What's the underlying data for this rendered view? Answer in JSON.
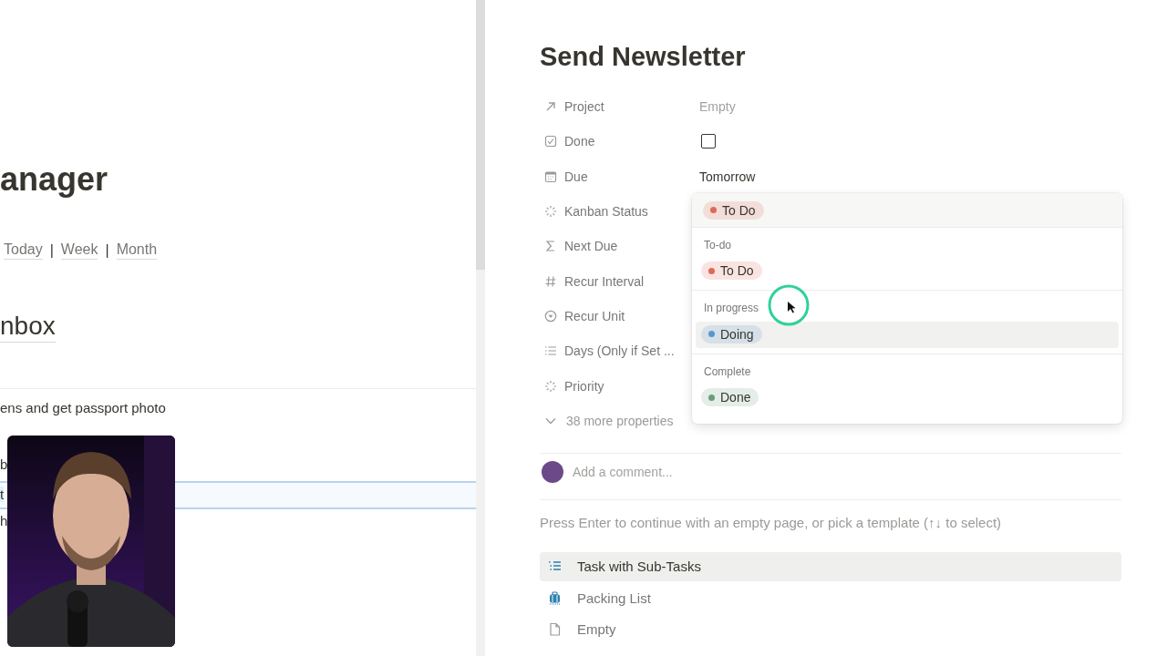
{
  "left_page": {
    "title": "anager",
    "links": [
      {
        "label": "Today"
      },
      {
        "label": "Week"
      },
      {
        "label": "Month"
      }
    ],
    "separator": "|",
    "section_title": "nbox",
    "rows": [
      {
        "text": "ens and get passport photo",
        "selected": false
      },
      {
        "text": "b",
        "selected": false
      },
      {
        "text": "t",
        "selected": true
      },
      {
        "text": "h",
        "selected": false
      }
    ]
  },
  "page": {
    "title": "Send Newsletter",
    "properties": [
      {
        "kind": "relation",
        "label": "Project",
        "placeholder": "Empty"
      },
      {
        "kind": "checkbox",
        "label": "Done",
        "checked": false
      },
      {
        "kind": "date",
        "label": "Due",
        "value": "Tomorrow"
      },
      {
        "kind": "status",
        "label": "Kanban Status"
      },
      {
        "kind": "formula",
        "label": "Next Due"
      },
      {
        "kind": "number",
        "label": "Recur Interval"
      },
      {
        "kind": "select",
        "label": "Recur Unit"
      },
      {
        "kind": "multiselect",
        "label": "Days (Only if Set ..."
      },
      {
        "kind": "status",
        "label": "Priority"
      }
    ],
    "more_properties": "38 more properties",
    "comment_placeholder": "Add a comment...",
    "template_hint": "Press Enter to continue with an empty page, or pick a template (↑↓ to select)",
    "templates": [
      {
        "kind": "checklist",
        "label": "Task with Sub-Tasks",
        "selected": true
      },
      {
        "kind": "luggage",
        "label": "Packing List",
        "selected": false
      },
      {
        "kind": "page",
        "label": "Empty",
        "selected": false
      }
    ]
  },
  "status_menu": {
    "current": {
      "label": "To Do",
      "color": "#e0685a"
    },
    "groups": [
      {
        "name": "To-do",
        "options": [
          {
            "label": "To Do",
            "color": "#e0685a",
            "highlighted": false
          }
        ]
      },
      {
        "name": "In progress",
        "options": [
          {
            "label": "Doing",
            "color": "#5a97c9",
            "highlighted": true
          }
        ]
      },
      {
        "name": "Complete",
        "options": [
          {
            "label": "Done",
            "color": "#6c9b7d",
            "highlighted": false
          }
        ]
      }
    ]
  },
  "cursor": {
    "kind": "pointer"
  }
}
